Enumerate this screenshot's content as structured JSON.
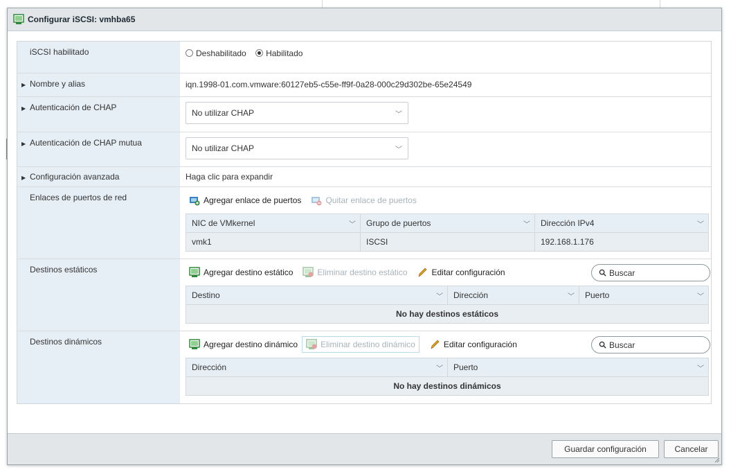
{
  "window": {
    "title": "Configurar iSCSI: vmhba65"
  },
  "rows": {
    "enabled": {
      "label": "iSCSI habilitado",
      "opt_disabled": "Deshabilitado",
      "opt_enabled": "Habilitado",
      "selected": "Habilitado"
    },
    "name": {
      "label": "Nombre y alias",
      "value": "iqn.1998-01.com.vmware:60127eb5-c55e-ff9f-0a28-000c29d302be-65e24549"
    },
    "chap": {
      "label": "Autenticación de CHAP",
      "value": "No utilizar CHAP"
    },
    "mutual_chap": {
      "label": "Autenticación de CHAP mutua",
      "value": "No utilizar CHAP"
    },
    "advanced": {
      "label": "Configuración avanzada",
      "value": "Haga clic para expandir"
    },
    "port_bindings": {
      "label": "Enlaces de puertos de red",
      "add": "Agregar enlace de puertos",
      "remove": "Quitar enlace de puertos",
      "columns": [
        "NIC de VMkernel",
        "Grupo de puertos",
        "Dirección IPv4"
      ],
      "rows": [
        [
          "vmk1",
          "ISCSI",
          "192.168.1.176"
        ]
      ]
    },
    "static": {
      "label": "Destinos estáticos",
      "add": "Agregar destino estático",
      "remove": "Eliminar destino estático",
      "edit": "Editar configuración",
      "search": "Buscar",
      "columns": [
        "Destino",
        "Dirección",
        "Puerto"
      ],
      "empty": "No hay destinos estáticos"
    },
    "dynamic": {
      "label": "Destinos dinámicos",
      "add": "Agregar destino dinámico",
      "remove": "Eliminar destino dinámico",
      "edit": "Editar configuración",
      "search": "Buscar",
      "columns": [
        "Dirección",
        "Puerto"
      ],
      "empty": "No hay destinos dinámicos"
    }
  },
  "footer": {
    "save": "Guardar configuración",
    "cancel": "Cancelar"
  },
  "icons": {
    "title": "iscsi-adapter-icon",
    "port_add": "network-add-icon",
    "port_remove": "network-remove-icon",
    "target_add": "target-add-icon",
    "target_remove": "target-remove-icon",
    "edit": "pencil-icon",
    "search": "magnifier-icon"
  },
  "colors": {
    "label_bg": "#e6eff6",
    "titlebar_bg": "#e2e6e9",
    "icon_green": "#2e8b3a",
    "pencil": "#e0a020"
  }
}
